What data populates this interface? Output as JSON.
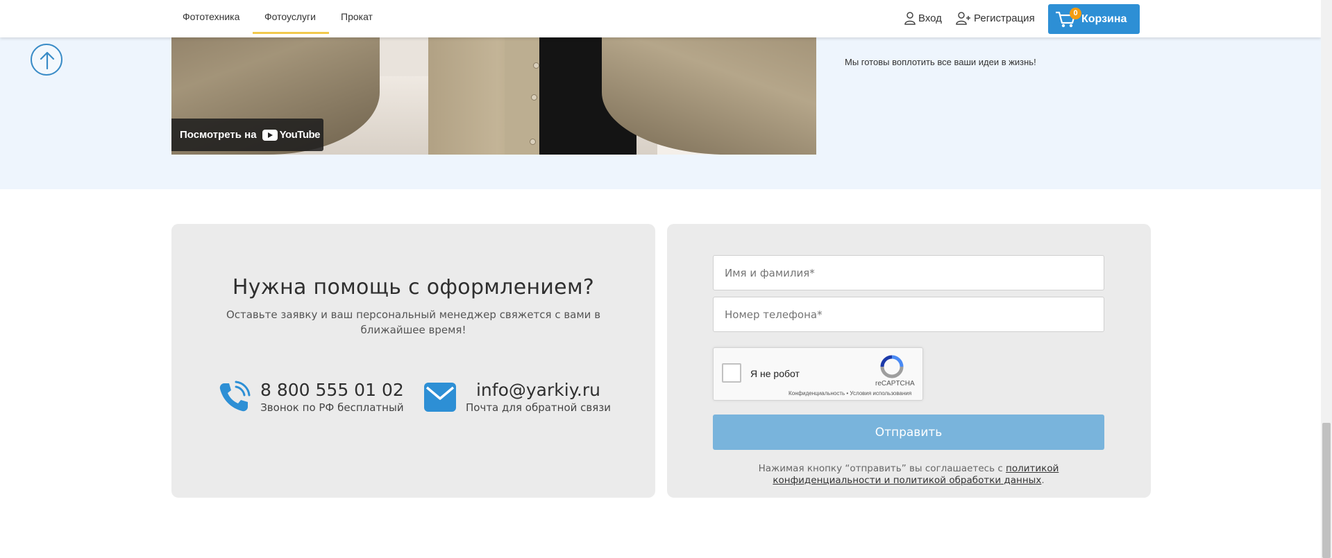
{
  "header": {
    "nav": [
      "Фототехника",
      "Фотоуслуги",
      "Прокат"
    ],
    "login": "Вход",
    "register": "Регистрация",
    "cart_label": "Корзина",
    "cart_count": "0"
  },
  "video": {
    "watch_label": "Посмотреть на",
    "yt_brand": "YouTube",
    "caption": "Мы готовы воплотить все ваши идеи в жизнь!"
  },
  "help": {
    "title": "Нужна помощь с оформлением?",
    "subtitle": "Оставьте заявку и ваш персональный менеджер свяжется с вами в ближайшее время!",
    "phone": "8 800 555 01 02",
    "phone_note": "Звонок по РФ бесплатный",
    "email": "info@yarkiy.ru",
    "email_note": "Почта для обратной связи"
  },
  "form": {
    "name_placeholder": "Имя и фамилия*",
    "phone_placeholder": "Номер телефона*",
    "captcha_label": "Я не робот",
    "captcha_brand": "reCAPTCHA",
    "captcha_terms": "Конфиденциальность • Условия использования",
    "submit_label": "Отправить",
    "agree_prefix": "Нажимая кнопку “отправить” вы соглашаетесь с ",
    "agree_link": "политикой конфиденциальности и политикой обработки данных",
    "agree_suffix": "."
  },
  "colors": {
    "accent": "#2d8fd5",
    "nav_active": "#f2c94c",
    "badge": "#f39c12",
    "submit_disabled": "#79b4dc",
    "section_bg": "#eef5fd",
    "card_bg": "#ebebeb"
  }
}
